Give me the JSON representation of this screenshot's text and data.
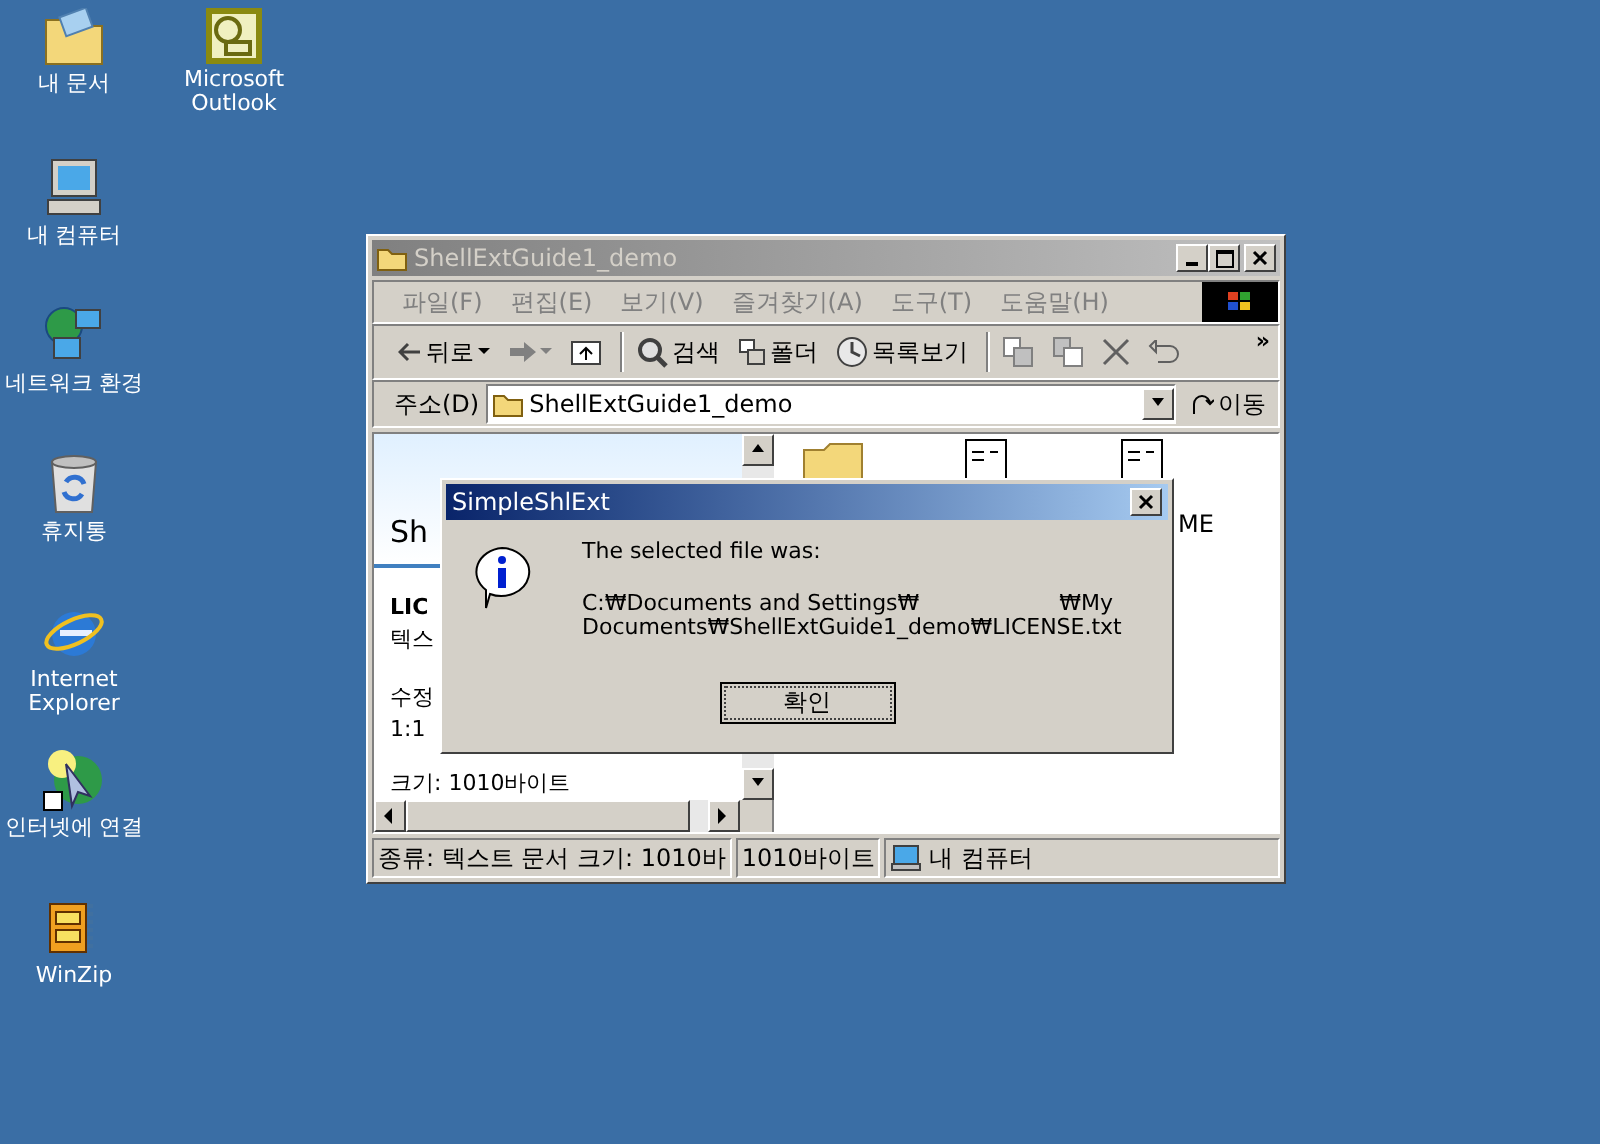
{
  "desktop_columns": [
    [
      {
        "label": "내 문서",
        "kind": "documents"
      },
      {
        "label": "내 컴퓨터",
        "kind": "computer"
      },
      {
        "label": "네트워크 환경",
        "kind": "network"
      },
      {
        "label": "휴지통",
        "kind": "recycle"
      },
      {
        "label": "Internet Explorer",
        "kind": "browser"
      },
      {
        "label": "인터넷에 연결",
        "kind": "connect"
      },
      {
        "label": "WinZip",
        "kind": "zip"
      }
    ],
    [
      {
        "label": "Microsoft Outlook",
        "kind": "outlook"
      }
    ]
  ],
  "explorer": {
    "title": "ShellExtGuide1_demo",
    "active": false,
    "menu": [
      "파일(F)",
      "편집(E)",
      "보기(V)",
      "즐겨찾기(A)",
      "도구(T)",
      "도움말(H)"
    ],
    "toolbar": [
      {
        "kind": "back",
        "label": "뒤로"
      },
      {
        "kind": "forward"
      },
      {
        "kind": "up"
      },
      {
        "kind": "search",
        "label": "검색"
      },
      {
        "kind": "folders",
        "label": "폴더"
      },
      {
        "kind": "history",
        "label": "목록보기"
      },
      {
        "kind": "move"
      },
      {
        "kind": "copy"
      },
      {
        "kind": "delete"
      },
      {
        "kind": "undo"
      }
    ],
    "toolbar_more": "»",
    "address": {
      "label": "주소(D)",
      "value": "ShellExtGuide1_demo",
      "go": "이동"
    },
    "left_pane": {
      "title": "Sh",
      "file_name": "LIC",
      "file_type": "텍스",
      "modified_label": "수정",
      "modified_time": "1:1",
      "size": "크기: 1010바이트"
    },
    "right_pane": {
      "item_label": "ME"
    },
    "status_bar": [
      "종류: 텍스트 문서 크기: 1010바",
      "1010바이트",
      "내 컴퓨터"
    ]
  },
  "dialog": {
    "title": "SimpleShlExt",
    "message": "The selected file was:",
    "path_lines": [
      "C:₩Documents and Settings₩                    ₩My",
      "Documents₩ShellExtGuide1_demo₩LICENSE.txt"
    ],
    "button": "확인"
  }
}
